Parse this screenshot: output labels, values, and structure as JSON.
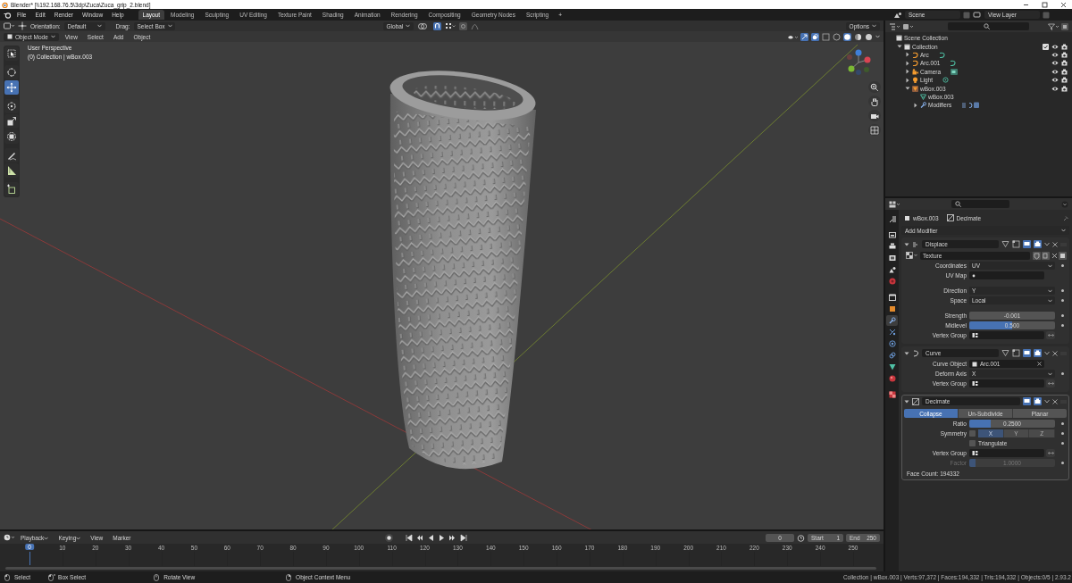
{
  "window": {
    "title": "Blender* [\\\\192.168.76.5\\3dp\\Zuca\\Zuca_grip_2.blend]"
  },
  "menu_bar": {
    "menus": [
      "File",
      "Edit",
      "Render",
      "Window",
      "Help"
    ],
    "workspaces": [
      {
        "label": "Layout",
        "selected": true
      },
      {
        "label": "Modeling",
        "selected": false
      },
      {
        "label": "Sculpting",
        "selected": false
      },
      {
        "label": "UV Editing",
        "selected": false
      },
      {
        "label": "Texture Paint",
        "selected": false
      },
      {
        "label": "Shading",
        "selected": false
      },
      {
        "label": "Animation",
        "selected": false
      },
      {
        "label": "Rendering",
        "selected": false
      },
      {
        "label": "Compositing",
        "selected": false
      },
      {
        "label": "Geometry Nodes",
        "selected": false
      },
      {
        "label": "Scripting",
        "selected": false
      }
    ],
    "add_workspace": "+",
    "scene": "Scene",
    "view_layer": "View Layer"
  },
  "viewport": {
    "orientation_label": "Orientation:",
    "orientation": "Default",
    "drag_label": "Drag:",
    "drag": "Select Box",
    "transform_orientation": "Global",
    "options": "Options",
    "mode": "Object Mode",
    "menus": [
      "View",
      "Select",
      "Add",
      "Object"
    ],
    "overlay_lines": [
      "User Perspective",
      "(0) Collection | wBox.003"
    ],
    "tools": [
      {
        "kind": "select-box",
        "selected": false
      },
      {
        "kind": "cursor",
        "selected": false
      },
      {
        "kind": "move",
        "selected": true
      },
      {
        "kind": "rotate",
        "selected": false
      },
      {
        "kind": "scale",
        "selected": false
      },
      {
        "kind": "transform",
        "selected": false
      },
      {
        "kind": "annotate",
        "selected": false
      },
      {
        "kind": "measure",
        "selected": false
      },
      {
        "kind": "add-cube",
        "selected": false
      }
    ]
  },
  "outliner": {
    "items": [
      {
        "label": "Scene Collection",
        "kind": "scene-collection",
        "children": [
          {
            "label": "Collection",
            "kind": "collection",
            "expanded": true,
            "checked": true,
            "children": [
              {
                "label": "Arc",
                "kind": "curve",
                "expanded": false
              },
              {
                "label": "Arc.001",
                "kind": "curve",
                "expanded": false
              },
              {
                "label": "Camera",
                "kind": "camera",
                "expanded": false
              },
              {
                "label": "Light",
                "kind": "light",
                "expanded": false
              },
              {
                "label": "wBox.003",
                "kind": "mesh-object",
                "expanded": true,
                "children": [
                  {
                    "label": "wBox.003",
                    "kind": "mesh-data"
                  },
                  {
                    "label": "Modifiers",
                    "kind": "modifiers",
                    "expanded": false
                  }
                ]
              }
            ]
          }
        ]
      }
    ]
  },
  "properties": {
    "tabs": [
      {
        "kind": "tool",
        "selected": false
      },
      {
        "kind": "render",
        "selected": false
      },
      {
        "kind": "output",
        "selected": false
      },
      {
        "kind": "view-layer",
        "selected": false
      },
      {
        "kind": "scene",
        "selected": false
      },
      {
        "kind": "world",
        "selected": false
      },
      {
        "kind": "collection",
        "selected": false
      },
      {
        "kind": "object",
        "selected": false
      },
      {
        "kind": "modifiers",
        "selected": true
      },
      {
        "kind": "particles",
        "selected": false
      },
      {
        "kind": "physics",
        "selected": false
      },
      {
        "kind": "constraints",
        "selected": false
      },
      {
        "kind": "data",
        "selected": false
      },
      {
        "kind": "material",
        "selected": false
      },
      {
        "kind": "texture",
        "selected": false
      }
    ],
    "object": "wBox.003",
    "modifier": "Decimate",
    "add_modifier": "Add Modifier",
    "modifiers": [
      {
        "name": "Displace",
        "kind": "displace",
        "expanded": true,
        "active": false,
        "rows": [
          {
            "kind": "texture",
            "value": "Texture"
          },
          {
            "kind": "dropdown",
            "label": "Coordinates",
            "value": "UV"
          },
          {
            "kind": "uvmap",
            "label": "UV Map"
          },
          {
            "kind": "gap"
          },
          {
            "kind": "dropdown",
            "label": "Direction",
            "value": "Y"
          },
          {
            "kind": "dropdown",
            "label": "Space",
            "value": "Local"
          },
          {
            "kind": "gap"
          },
          {
            "kind": "slider",
            "label": "Strength",
            "value": "-0.001"
          },
          {
            "kind": "slider",
            "label": "Midlevel",
            "value": "0.500",
            "level": 0.5
          },
          {
            "kind": "group",
            "label": "Vertex Group"
          }
        ]
      },
      {
        "name": "Curve",
        "kind": "curve",
        "expanded": true,
        "active": false,
        "rows": [
          {
            "kind": "object",
            "label": "Curve Object",
            "value": "Arc.001"
          },
          {
            "kind": "dropdown",
            "label": "Deform Axis",
            "value": "X"
          },
          {
            "kind": "group",
            "label": "Vertex Group"
          }
        ]
      },
      {
        "name": "Decimate",
        "kind": "decimate",
        "expanded": true,
        "active": true,
        "rows": [
          {
            "kind": "tabs",
            "options": [
              {
                "label": "Collapse",
                "selected": true
              },
              {
                "label": "Un-Subdivide",
                "selected": false
              },
              {
                "label": "Planar",
                "selected": false
              }
            ]
          },
          {
            "kind": "slider",
            "label": "Ratio",
            "value": "0.2500",
            "level": 0.25
          },
          {
            "kind": "axes",
            "label": "Symmetry",
            "checked": false,
            "options": [
              {
                "label": "X",
                "selected": true
              },
              {
                "label": "Y",
                "selected": false
              },
              {
                "label": "Z",
                "selected": false
              }
            ]
          },
          {
            "kind": "checkbox",
            "label": "Triangulate",
            "checked": false
          },
          {
            "kind": "group",
            "label": "Vertex Group"
          },
          {
            "kind": "slider",
            "label": "Factor",
            "value": "1.0000",
            "level": 0.07,
            "disabled": true
          },
          {
            "kind": "info",
            "value": "Face Count: 194332"
          }
        ]
      }
    ]
  },
  "timeline": {
    "menus": [
      {
        "label": "Playback",
        "dropdown": true
      },
      {
        "label": "Keying",
        "dropdown": true
      },
      {
        "label": "View",
        "dropdown": false
      },
      {
        "label": "Marker",
        "dropdown": false
      }
    ],
    "current_frame": "0",
    "start_label": "Start",
    "start": "1",
    "end_label": "End",
    "end": "250",
    "playhead": "0",
    "ticks": [
      "10",
      "20",
      "30",
      "40",
      "50",
      "60",
      "70",
      "80",
      "90",
      "100",
      "110",
      "120",
      "130",
      "140",
      "150",
      "160",
      "170",
      "180",
      "190",
      "200",
      "210",
      "220",
      "230",
      "240",
      "250"
    ]
  },
  "status_bar": {
    "hints": [
      {
        "kind": "mouse-left",
        "label": "Select"
      },
      {
        "kind": "mouse-drag",
        "label": "Box Select"
      },
      {
        "kind": "mouse-middle",
        "label": "Rotate View"
      },
      {
        "kind": "mouse-right",
        "label": "Object Context Menu"
      }
    ],
    "stats": "Collection | wBox.003 | Verts:97,372 | Faces:194,332 | Tris:194,332 | Objects:0/5 | 2.93.2"
  }
}
